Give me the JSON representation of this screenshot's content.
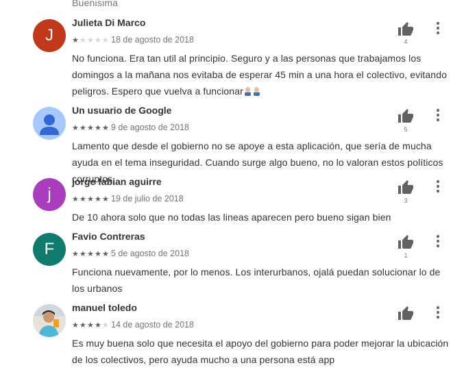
{
  "partial_text": "Buenisima",
  "reviews": [
    {
      "author": "Julieta Di Marco",
      "avatar_letter": "J",
      "avatar_color": "#c0391b",
      "rating": 1,
      "date": "18 de agosto de 2018",
      "text": "No funciona. Era tan util al principio. Seguro y a las personas que trabajamos los domingos a la mañana nos evitaba de esperar 45 min a una hora el colectivo, evitando peligros. Espero que vuelva a funcionar",
      "helpful_count": "4"
    },
    {
      "author": "Un usuario de Google",
      "avatar_letter": "",
      "avatar_color": "#a6c8ff",
      "rating": 5,
      "date": "9 de agosto de 2018",
      "text": "Lamento que desde el gobierno no se apoye a esta aplicación, que sería de mucha ayuda en el tema inseguridad. Cuando surge algo bueno, no lo valoran estos políticos corruptos",
      "helpful_count": "5"
    },
    {
      "author": "jorge fabian aguirre",
      "avatar_letter": "j",
      "avatar_color": "#a93dbd",
      "rating": 5,
      "date": "19 de julio de 2018",
      "text": "De 10 ahora solo que no todas las lineas aparecen pero bueno sigan bien",
      "helpful_count": "3"
    },
    {
      "author": "Favio Contreras",
      "avatar_letter": "F",
      "avatar_color": "#0f7b6c",
      "rating": 5,
      "date": "5 de agosto de 2018",
      "text": "Funciona nuevamente, por lo menos. Los interurbanos, ojalá puedan solucionar lo de los urbanos",
      "helpful_count": "1"
    },
    {
      "author": "manuel toledo",
      "avatar_letter": "",
      "avatar_color": "#d9d4cc",
      "rating": 4,
      "date": "14 de agosto de 2018",
      "text": "Es muy buena solo que necesita el apoyo del gobierno para poder mejorar la ubicación de los colectivos, pero ayuda mucho a una persona está app",
      "helpful_count": ""
    }
  ],
  "icons": {
    "helpful": "thumb-up-icon",
    "menu": "more-vert-icon",
    "star": "star-icon",
    "emoji": "old-man-emoji-icon"
  },
  "colors": {
    "star_filled": "#616161",
    "star_empty": "#d6d6d6",
    "icon": "#616161"
  }
}
